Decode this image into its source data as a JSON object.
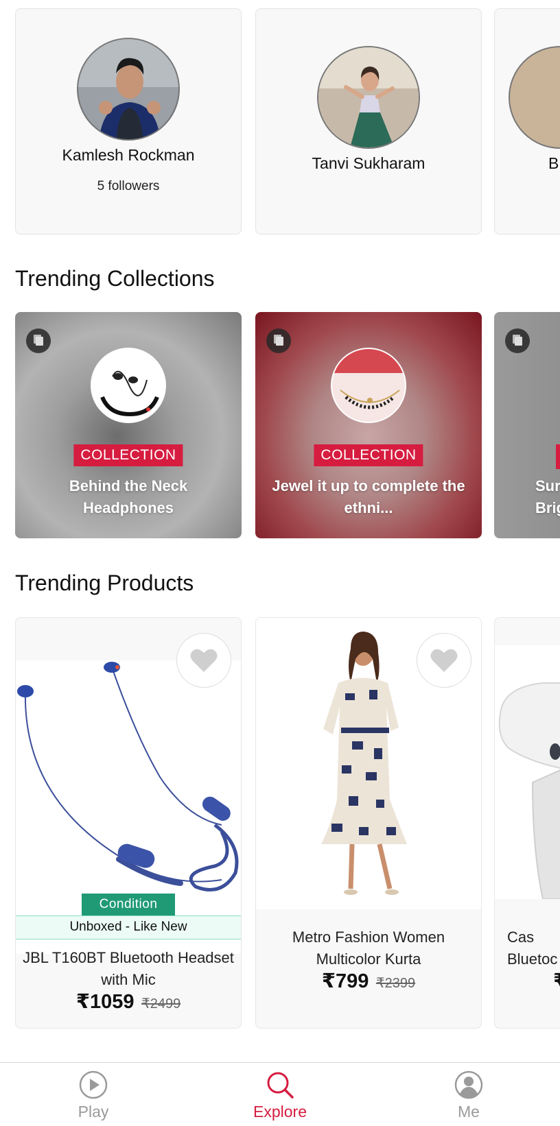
{
  "creators": [
    {
      "name": "Kamlesh Rockman",
      "followers": "5 followers"
    },
    {
      "name": "Tanvi Sukharam",
      "followers": ""
    },
    {
      "name": "B",
      "followers": ""
    }
  ],
  "sections": {
    "collections_title": "Trending Collections",
    "products_title": "Trending Products"
  },
  "collections": [
    {
      "tag": "COLLECTION",
      "title": "Behind the Neck Headphones"
    },
    {
      "tag": "COLLECTION",
      "title": "Jewel it up to complete the ethni..."
    },
    {
      "tag": "",
      "title": "Sur Brigl"
    }
  ],
  "products": [
    {
      "name": "JBL T160BT Bluetooth Headset with Mic",
      "price": "₹1059",
      "mrp": "₹2499",
      "condition_label": "Condition",
      "condition_value": "Unboxed - Like New"
    },
    {
      "name": "Metro Fashion Women Multicolor Kurta",
      "price": "₹799",
      "mrp": "₹2399"
    },
    {
      "name": "Cas Bluetoc",
      "price": "₹"
    }
  ],
  "nav": {
    "items": [
      {
        "label": "Play",
        "icon": "play-icon"
      },
      {
        "label": "Explore",
        "icon": "search-icon",
        "active": true
      },
      {
        "label": "Me",
        "icon": "profile-icon"
      }
    ]
  },
  "colors": {
    "accent": "#d61c3f",
    "condition": "#1f9a74"
  }
}
